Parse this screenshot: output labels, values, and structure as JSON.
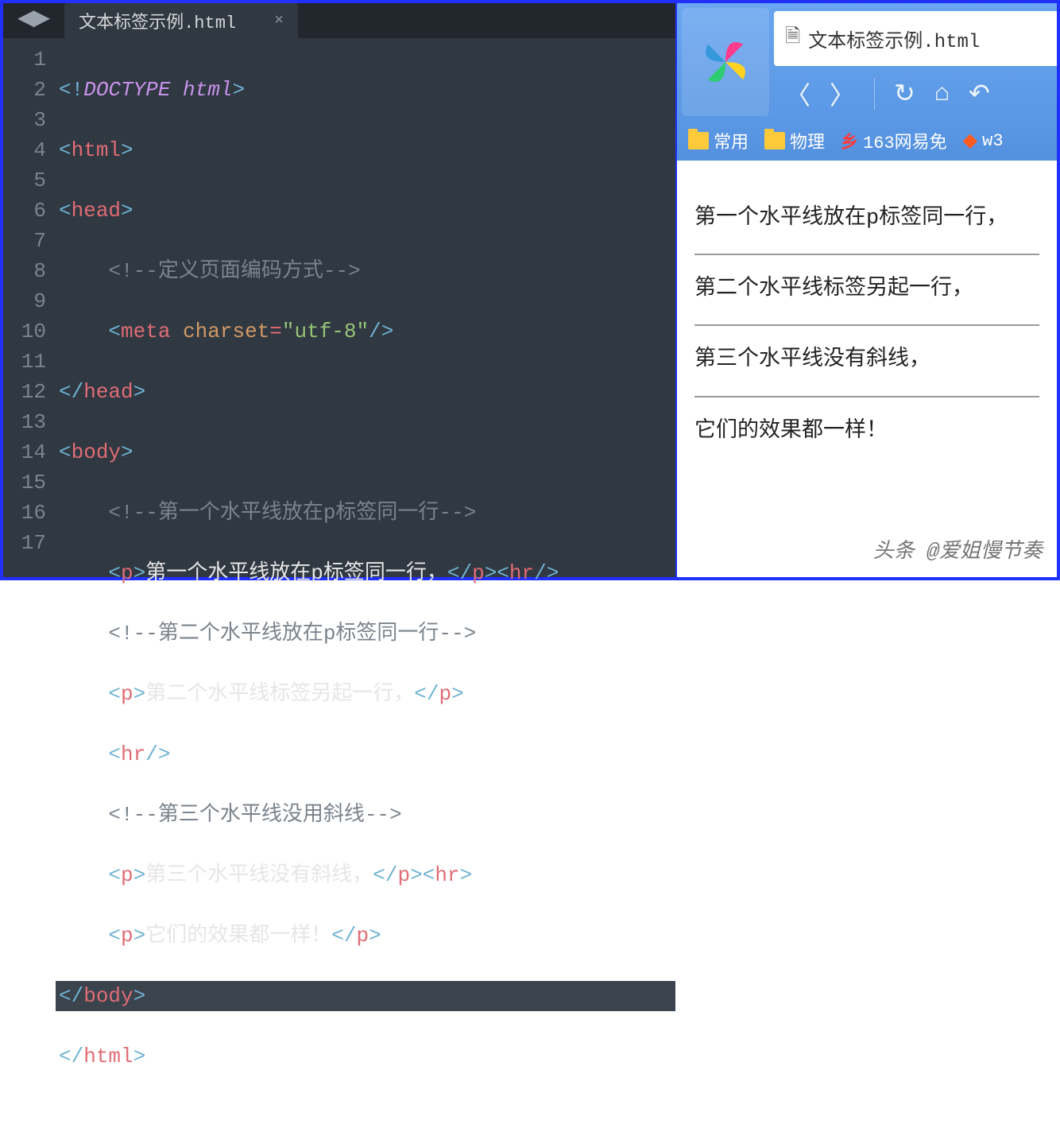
{
  "editor": {
    "tab_title": "文本标签示例.html",
    "lines": [
      "1",
      "2",
      "3",
      "4",
      "5",
      "6",
      "7",
      "8",
      "9",
      "10",
      "11",
      "12",
      "13",
      "14",
      "15",
      "16",
      "17"
    ],
    "code": {
      "l1": {
        "doctype1": "DOCTYPE",
        "doctype2": "html"
      },
      "l2": {
        "tag": "html"
      },
      "l3": {
        "tag": "head"
      },
      "l4": {
        "comment": "<!--定义页面编码方式-->"
      },
      "l5": {
        "tag": "meta",
        "attr": "charset",
        "val": "\"utf-8\""
      },
      "l6": {
        "tag": "head"
      },
      "l7": {
        "tag": "body"
      },
      "l8": {
        "comment": "<!--第一个水平线放在p标签同一行-->"
      },
      "l9": {
        "tag": "p",
        "text": "第一个水平线放在p标签同一行，",
        "hr": "hr"
      },
      "l10": {
        "comment": "<!--第二个水平线放在p标签同一行-->"
      },
      "l11": {
        "tag": "p",
        "text": "第二个水平线标签另起一行，"
      },
      "l12": {
        "hr": "hr"
      },
      "l13": {
        "comment": "<!--第三个水平线没用斜线-->"
      },
      "l14": {
        "tag": "p",
        "text": "第三个水平线没有斜线，",
        "hr": "hr"
      },
      "l15": {
        "tag": "p",
        "text": "它们的效果都一样！"
      },
      "l16": {
        "tag": "body"
      },
      "l17": {
        "tag": "html"
      }
    }
  },
  "browser": {
    "address": "文本标签示例.html",
    "bookmarks": {
      "b1": "常用",
      "b2": "物理",
      "b3": "163网易免",
      "b4": "w3"
    },
    "page": {
      "p1": "第一个水平线放在p标签同一行，",
      "p2": "第二个水平线标签另起一行，",
      "p3": "第三个水平线没有斜线，",
      "p4": "它们的效果都一样！"
    },
    "watermark": "头条 @爱姐慢节奏"
  }
}
